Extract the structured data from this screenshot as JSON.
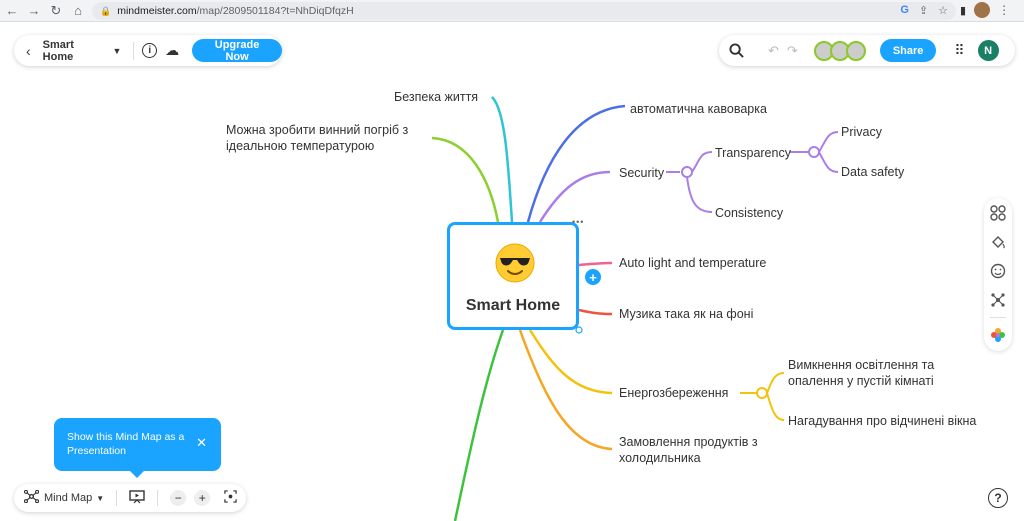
{
  "browser": {
    "url_host": "mindmeister.com",
    "url_path": "/map/2809501184?t=NhDiqDfqzH",
    "icons": [
      "back-arrow",
      "forward-arrow",
      "reload",
      "home",
      "lock",
      "google",
      "share",
      "star",
      "panel",
      "profile",
      "menu"
    ]
  },
  "header": {
    "map_title": "Smart Home",
    "upgrade_label": "Upgrade Now",
    "share_label": "Share",
    "user_initial": "N"
  },
  "mindmap": {
    "root": {
      "title": "Smart Home",
      "emoji": "sunglasses-face"
    },
    "nodes": {
      "bezpeka": "Безпека життя",
      "vynnyi_line1": "Можна зробити винний погріб з",
      "vynnyi_line2": "ідеальною температурою",
      "kavovarka": "автоматична кавоварка",
      "security": "Security",
      "transparency": "Transparency",
      "privacy": "Privacy",
      "data_safety": "Data safety",
      "consistency": "Consistency",
      "auto_light": "Auto light and temperature",
      "muzyka": "Музика така як на фоні",
      "enerho": "Енергозбереження",
      "vymknennia_line1": "Вимкнення освітлення та",
      "vymknennia_line2": "опалення у пустій кімнаті",
      "nahaduvannia": "Нагадування про відчинені вікна",
      "zamovlennia_line1": "Замовлення продуктів з",
      "zamovlennia_line2": "холодильника"
    },
    "branch_colors": {
      "cyan": "#2ec4d6",
      "lime": "#8ccf2f",
      "blue": "#4a6fe8",
      "purple": "#a97ee6",
      "pink": "#f06292",
      "red": "#f0533c",
      "yellow": "#f4c20d",
      "orange": "#f5a623",
      "green": "#3cc33c"
    }
  },
  "tooltip": {
    "text": "Show this Mind Map as a Presentation"
  },
  "bottom_toolbar": {
    "layout_label": "Mind Map"
  },
  "accent_color": "#1aa3ff"
}
